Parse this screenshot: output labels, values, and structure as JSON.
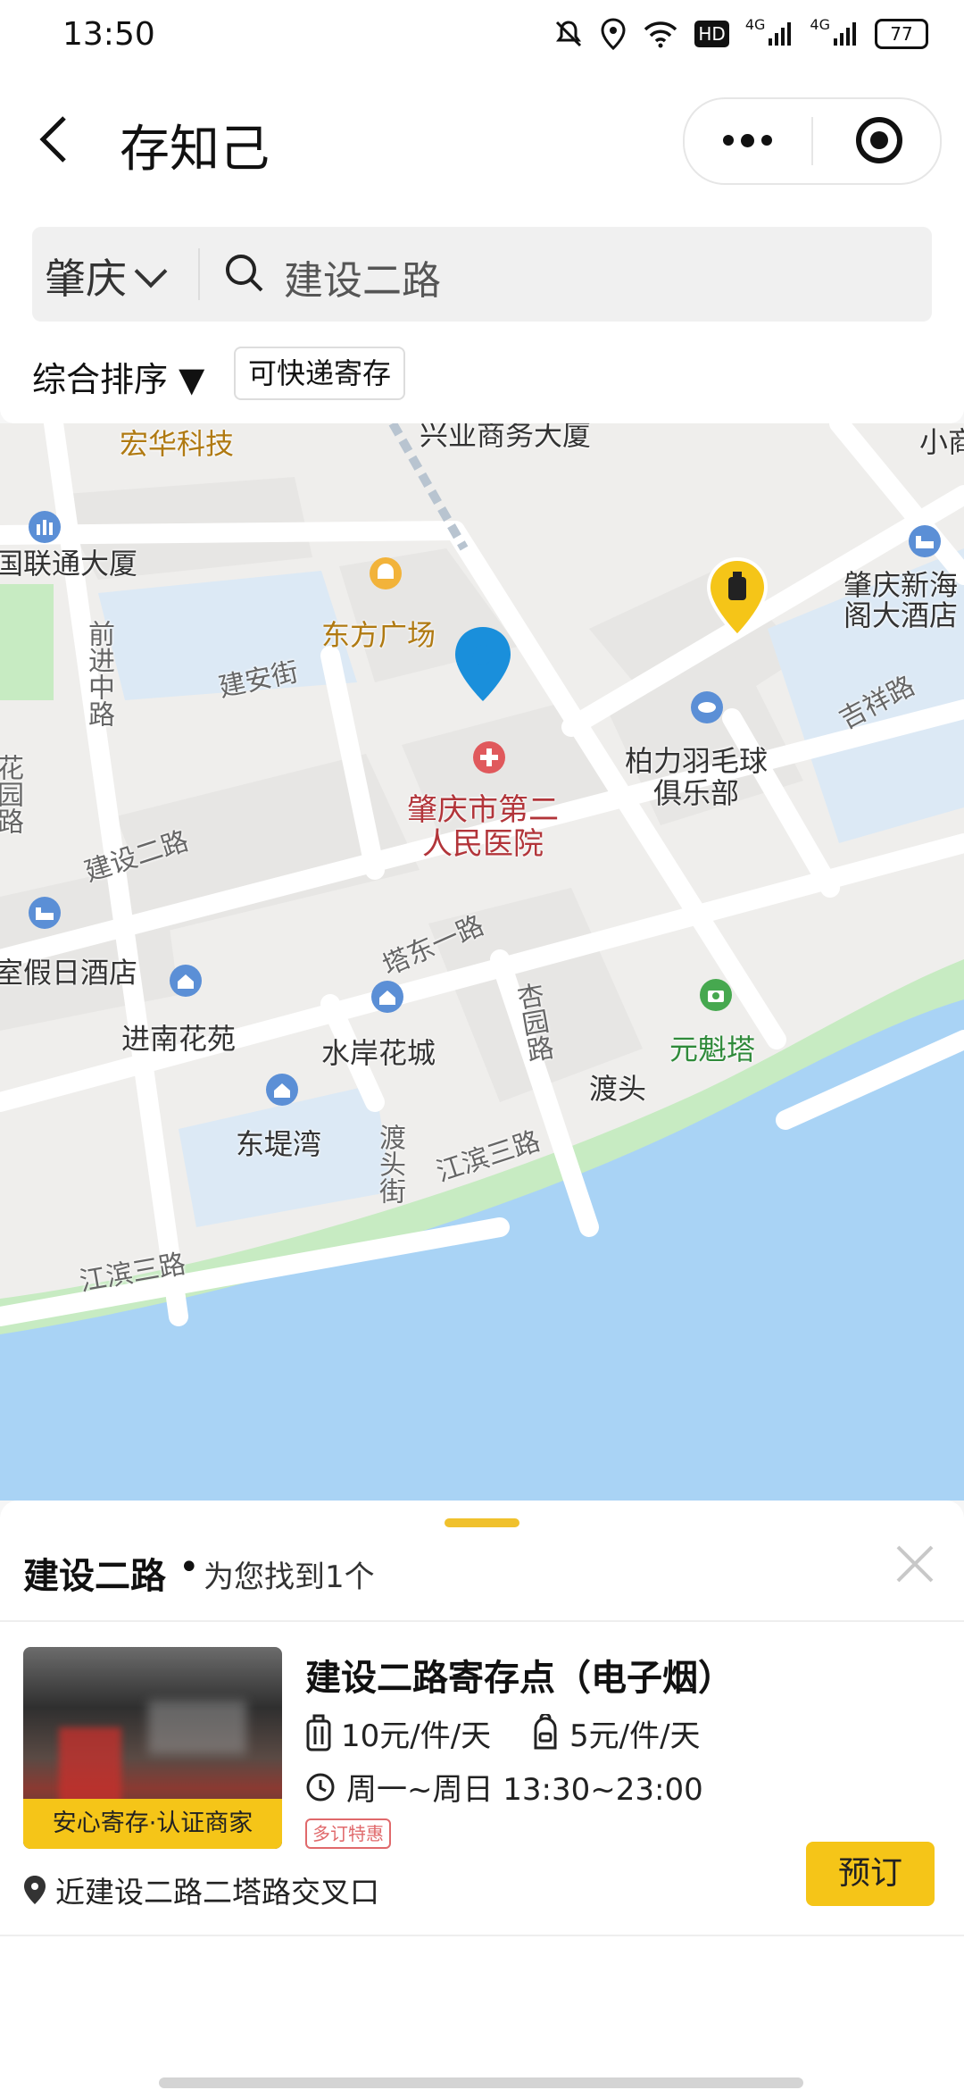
{
  "status_bar": {
    "time": "13:50",
    "icons": [
      "bell-off-icon",
      "location-icon",
      "wifi-icon",
      "hd-icon",
      "signal-4g-icon",
      "signal-4g-icon"
    ],
    "hd": "HD",
    "net1": "4G",
    "net2": "4G",
    "battery": "77"
  },
  "header": {
    "title": "存知己"
  },
  "search": {
    "city": "肇庆",
    "query": "建设二路"
  },
  "filters": {
    "sort_label": "综合排序 ▼",
    "express_tag": "可快递寄存"
  },
  "map": {
    "labels": {
      "honghua": "宏华科技",
      "xingye": "兴业商务大厦",
      "xiao": "小商",
      "liantong": "国联通大厦",
      "dongfang": "东方广场",
      "jianan": "建安街",
      "qianjin": "前进中路",
      "huayuan": "花园路",
      "zhaoqing_hotel": "肇庆新海\n阁大酒店",
      "jixiang": "吉祥路",
      "baili": "柏力羽毛球\n俱乐部",
      "hospital": "肇庆市第二\n人民医院",
      "jianshe_road": "建设二路",
      "holiday_hotel": "室假日酒店",
      "tadong": "塔东一路",
      "xingyuan": "杏园路",
      "jinnan": "进南花苑",
      "shuian": "水岸花城",
      "yuankui": "元魁塔",
      "dutou": "渡头",
      "dutoujie": "渡头街",
      "jiangbin_1": "江滨三路",
      "jiangbin_2": "江滨三路",
      "dongdi": "东堤湾"
    }
  },
  "results": {
    "keyword": "建设二路",
    "dot": "•",
    "count_text": "为您找到1个",
    "store": {
      "name": "建设二路寄存点（电子烟）",
      "badge": "安心寄存·认证商家",
      "price_luggage": "10元/件/天",
      "price_bag": "5元/件/天",
      "hours": "周一~周日 13:30~23:00",
      "promo": "多订特惠",
      "address": "近建设二路二塔路交叉口",
      "book_label": "预订"
    }
  },
  "colors": {
    "accent": "#f5c518",
    "map_land": "#efeeec",
    "map_water": "#a9d3f5",
    "map_green": "#c7ebc2",
    "map_block": "#e7e6e4",
    "pin_blue": "#1a8fdb"
  }
}
